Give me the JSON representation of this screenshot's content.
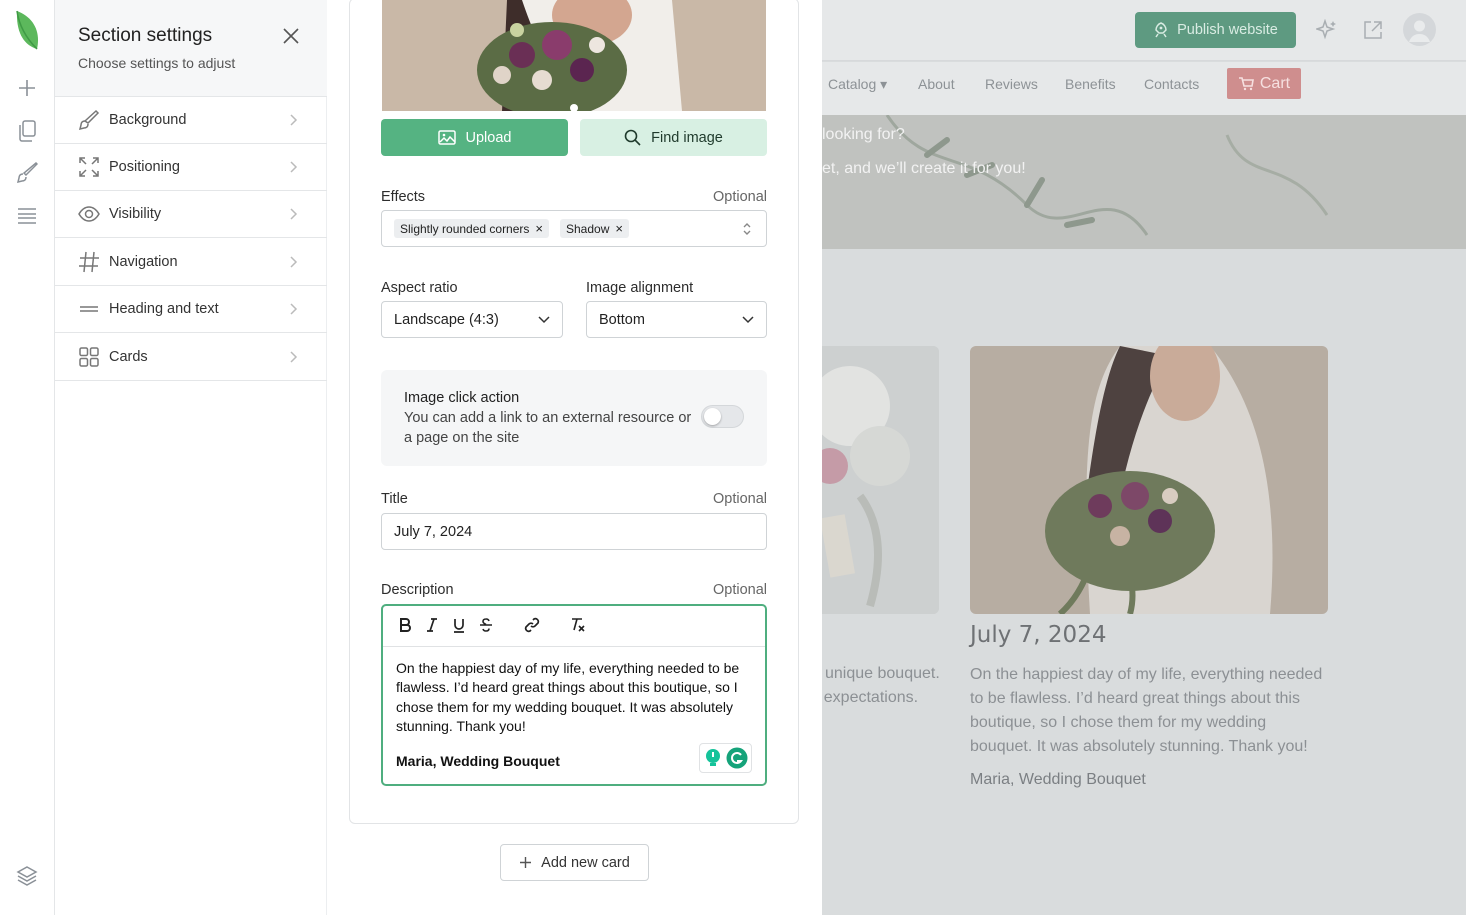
{
  "panel": {
    "title": "Section settings",
    "subtitle": "Choose settings to adjust",
    "items": [
      {
        "label": "Background",
        "icon": "brush-icon"
      },
      {
        "label": "Positioning",
        "icon": "expand-icon"
      },
      {
        "label": "Visibility",
        "icon": "eye-icon"
      },
      {
        "label": "Navigation",
        "icon": "hash-icon"
      },
      {
        "label": "Heading and text",
        "icon": "lines-icon"
      },
      {
        "label": "Cards",
        "icon": "grid-icon"
      }
    ]
  },
  "editor": {
    "upload_label": "Upload",
    "find_label": "Find image",
    "effects_label": "Effects",
    "optional": "Optional",
    "effects_chips": [
      "Slightly rounded corners",
      "Shadow"
    ],
    "aspect_label": "Aspect ratio",
    "aspect_value": "Landscape (4:3)",
    "align_label": "Image alignment",
    "align_value": "Bottom",
    "click_title": "Image click action",
    "click_desc": "You can add a link to an external resource or a page on the site",
    "click_enabled": false,
    "title_label": "Title",
    "title_value": "July 7, 2024",
    "desc_label": "Description",
    "desc_text": "On the happiest day of my life, everything needed to be flawless. I’d heard great things about this boutique, so I chose them for my wedding bouquet. It was absolutely stunning. Thank you!",
    "desc_author": "Maria, Wedding Bouquet",
    "add_card": "Add new card"
  },
  "site": {
    "publish": "Publish website",
    "nav": [
      "Catalog",
      "About",
      "Reviews",
      "Benefits",
      "Contacts"
    ],
    "cart": "Cart",
    "hero_line1": "looking for?",
    "hero_line2": "et, and we’ll create it for you!",
    "card_left_text1": "unique bouquet.",
    "card_left_text2": "expectations.",
    "card_title": "July 7, 2024",
    "card_text": "On the happiest day of my life, everything needed to be flawless. I’d heard great things about this boutique, so I chose them for my wedding bouquet. It was absolutely stunning. Thank you!",
    "card_author": "Maria, Wedding Bouquet"
  },
  "colors": {
    "accent": "#55b382",
    "accent_light": "#d8f0e3",
    "publish": "#5e9a81",
    "cart": "#cf8e8e"
  }
}
